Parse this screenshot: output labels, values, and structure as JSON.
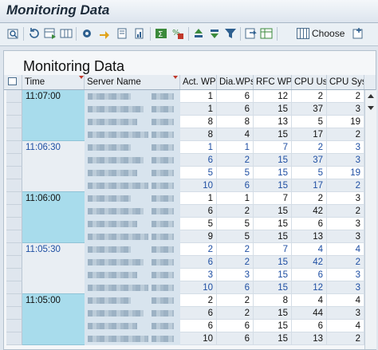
{
  "window": {
    "title": "Monitoring Data"
  },
  "toolbar": {
    "choose_label": "Choose"
  },
  "panel": {
    "title": "Monitoring Data"
  },
  "columns": [
    "Time",
    "Server Name",
    "Act. WPs",
    "Dia.WPs",
    "RFC WPs",
    "CPU Usr",
    "CPU Sys"
  ],
  "groups": [
    {
      "time": "11:07:00",
      "rows": [
        [
          "1",
          "6",
          "12",
          "2",
          "2"
        ],
        [
          "1",
          "6",
          "15",
          "37",
          "3"
        ],
        [
          "8",
          "8",
          "13",
          "5",
          "19"
        ],
        [
          "8",
          "4",
          "15",
          "17",
          "2"
        ]
      ]
    },
    {
      "time": "11:06:30",
      "rows": [
        [
          "1",
          "1",
          "7",
          "2",
          "3"
        ],
        [
          "6",
          "2",
          "15",
          "37",
          "3"
        ],
        [
          "5",
          "5",
          "15",
          "5",
          "19"
        ],
        [
          "10",
          "6",
          "15",
          "17",
          "2"
        ]
      ]
    },
    {
      "time": "11:06:00",
      "rows": [
        [
          "1",
          "1",
          "7",
          "2",
          "3"
        ],
        [
          "6",
          "2",
          "15",
          "42",
          "2"
        ],
        [
          "5",
          "5",
          "15",
          "6",
          "3"
        ],
        [
          "9",
          "5",
          "15",
          "13",
          "3"
        ]
      ]
    },
    {
      "time": "11:05:30",
      "rows": [
        [
          "2",
          "2",
          "7",
          "4",
          "4"
        ],
        [
          "6",
          "2",
          "15",
          "42",
          "2"
        ],
        [
          "3",
          "3",
          "15",
          "6",
          "3"
        ],
        [
          "10",
          "6",
          "15",
          "12",
          "3"
        ]
      ]
    },
    {
      "time": "11:05:00",
      "rows": [
        [
          "2",
          "2",
          "8",
          "4",
          "4"
        ],
        [
          "6",
          "2",
          "15",
          "44",
          "3"
        ],
        [
          "6",
          "6",
          "15",
          "6",
          "4"
        ],
        [
          "10",
          "6",
          "15",
          "13",
          "2"
        ]
      ]
    }
  ],
  "colors": {
    "time_highlight": "#a8dcec",
    "row_alt": "#e6ecf2",
    "row": "#ffffff",
    "blue_text": "#1f4fa3"
  },
  "icons": [
    "find-icon",
    "refresh-icon",
    "layout-icon",
    "settings-icon",
    "export-icon",
    "details-icon",
    "graph-icon",
    "sum-icon",
    "subtotal-icon",
    "sort-asc-icon",
    "sort-desc-icon",
    "filter-icon",
    "print-icon",
    "spreadsheet-icon",
    "choose-layout-icon",
    "more-icon"
  ]
}
